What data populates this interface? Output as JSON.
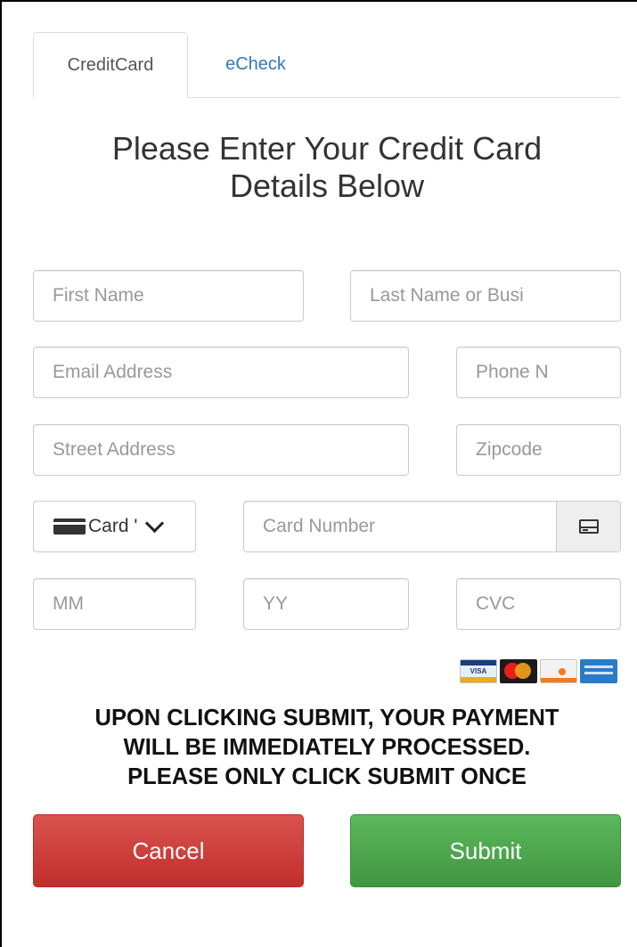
{
  "tabs": [
    {
      "label": "CreditCard",
      "active": true
    },
    {
      "label": "eCheck",
      "active": false
    }
  ],
  "heading": {
    "line1": "Please Enter Your Credit Card",
    "line2": "Details Below"
  },
  "fields": {
    "first_name": {
      "placeholder": "First Name",
      "value": ""
    },
    "last_name": {
      "placeholder": "Last Name or Busi",
      "value": ""
    },
    "email": {
      "placeholder": "Email Address",
      "value": ""
    },
    "phone": {
      "placeholder": "Phone N",
      "value": ""
    },
    "street": {
      "placeholder": "Street Address",
      "value": ""
    },
    "zip": {
      "placeholder": "Zipcode",
      "value": ""
    },
    "card_type": {
      "selected": "Card '"
    },
    "card_number": {
      "placeholder": "Card Number",
      "value": ""
    },
    "mm": {
      "placeholder": "MM",
      "value": ""
    },
    "yy": {
      "placeholder": "YY",
      "value": ""
    },
    "cvc": {
      "placeholder": "CVC",
      "value": ""
    }
  },
  "card_logos": {
    "visa": "VISA",
    "icons": [
      "visa-logo-icon",
      "mastercard-logo-icon",
      "discover-logo-icon",
      "amex-logo-icon"
    ]
  },
  "warning": {
    "line1": "UPON CLICKING SUBMIT, YOUR PAYMENT",
    "line2": "WILL BE IMMEDIATELY PROCESSED.",
    "line3": "PLEASE ONLY CLICK SUBMIT ONCE"
  },
  "buttons": {
    "cancel": "Cancel",
    "submit": "Submit"
  },
  "colors": {
    "cancel": "#d9534f",
    "submit": "#5cb85c",
    "link": "#337ab7"
  }
}
